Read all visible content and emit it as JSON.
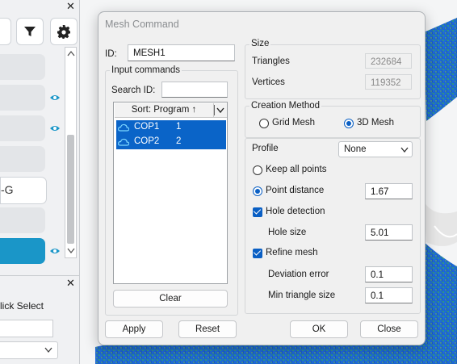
{
  "dialog": {
    "title": "Mesh Command",
    "id_label": "ID:",
    "id_value": "MESH1",
    "input_commands": {
      "group_label": "Input commands",
      "search_label": "Search ID:",
      "search_value": "",
      "sort_label": "Sort: Program ↑",
      "items": [
        {
          "name": "COP1",
          "program": "1",
          "selected": true
        },
        {
          "name": "COP2",
          "program": "2",
          "selected": true
        }
      ],
      "clear_label": "Clear"
    },
    "size": {
      "group_label": "Size",
      "triangles_label": "Triangles",
      "triangles_value": "232684",
      "vertices_label": "Vertices",
      "vertices_value": "119352"
    },
    "creation_method": {
      "group_label": "Creation Method",
      "grid_mesh_label": "Grid Mesh",
      "mesh3d_label": "3D Mesh",
      "selected": "3D Mesh"
    },
    "options": {
      "profile_label": "Profile",
      "profile_value": "None",
      "keep_all_points_label": "Keep all points",
      "point_distance_label": "Point distance",
      "point_distance_value": "1.67",
      "hole_detection_label": "Hole detection",
      "hole_detection_checked": true,
      "hole_size_label": "Hole size",
      "hole_size_value": "5.01",
      "refine_mesh_label": "Refine mesh",
      "refine_mesh_checked": true,
      "deviation_error_label": "Deviation error",
      "deviation_error_value": "0.1",
      "min_triangle_size_label": "Min triangle size",
      "min_triangle_size_value": "0.1"
    },
    "buttons": {
      "apply": "Apply",
      "reset": "Reset",
      "ok": "OK",
      "close": "Close"
    }
  },
  "left_panel": {
    "row_partial_text": "-G",
    "click_select_label": "lick Select",
    "close_glyph": "✕"
  },
  "colors": {
    "accent": "#0a64c8",
    "selected_row": "#1a96c8",
    "eye_icon": "#1a96c8"
  }
}
